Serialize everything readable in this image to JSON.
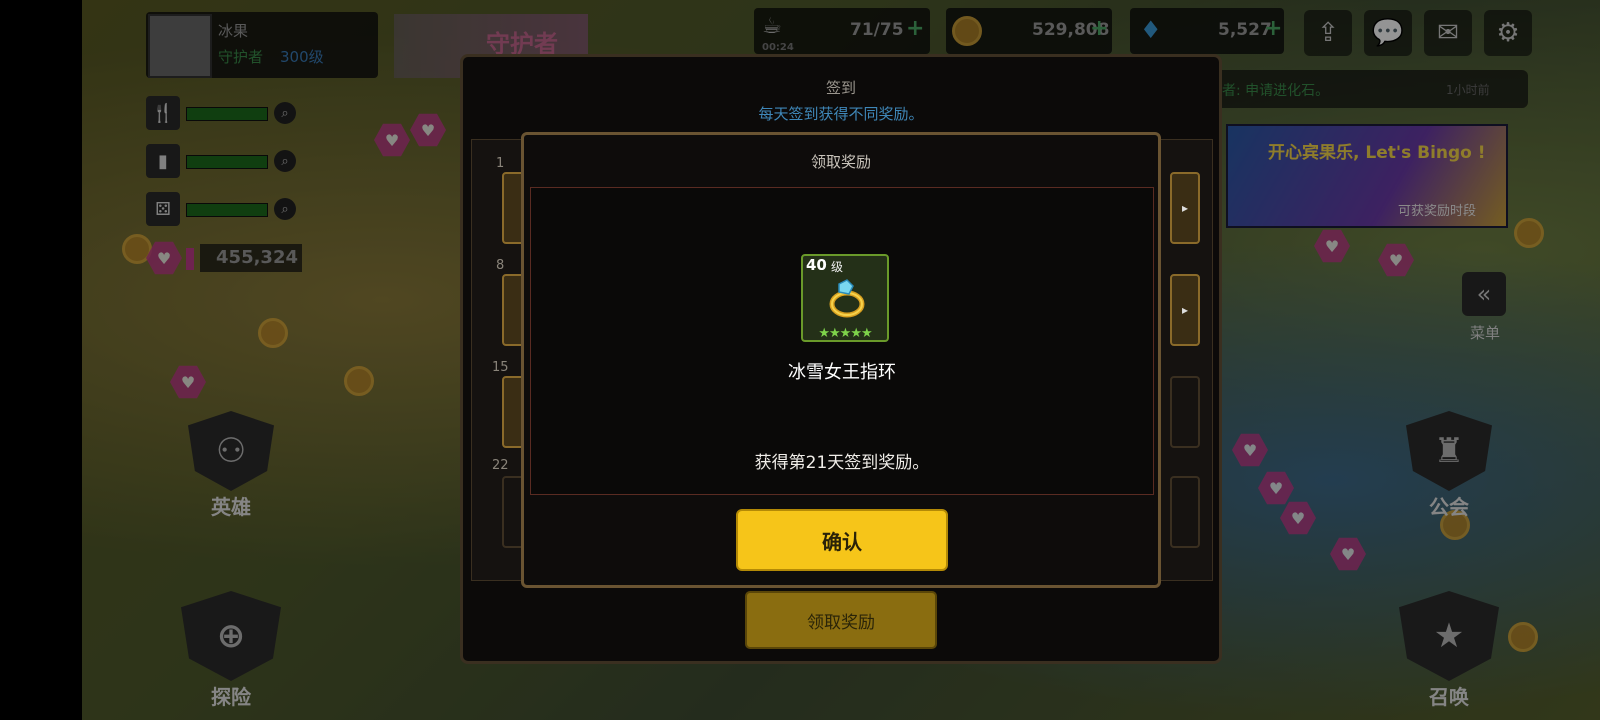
{
  "player": {
    "name": "冰果",
    "title": "守护者",
    "level": "300级",
    "banner_text": "守护者"
  },
  "stats": {
    "points": "455,324"
  },
  "resources": {
    "stamina": {
      "value": "71/75",
      "sub": "00:24"
    },
    "gold": {
      "value": "529,808"
    },
    "gems": {
      "value": "5,527"
    }
  },
  "chat": {
    "message": "者: 申请进化石。",
    "time": "1小时前"
  },
  "event_banner": {
    "title": "开心宾果乐, Let's Bingo !",
    "caption": "可获奖励时段"
  },
  "side_left": {
    "heroes": "英雄",
    "explore": "探险"
  },
  "side_right": {
    "menu": "菜单",
    "guild": "公会",
    "summon": "召唤"
  },
  "signin_dialog": {
    "title": "签到",
    "subtitle": "每天签到获得不同奖励。",
    "row_numbers": [
      "1",
      "8",
      "15",
      "22"
    ],
    "claim_button": "领取奖励"
  },
  "reward_modal": {
    "title": "领取奖励",
    "item": {
      "level": "40",
      "level_unit": "级",
      "stars": "★★★★★",
      "name": "冰雪女王指环"
    },
    "message": "获得第21天签到奖励。",
    "confirm_button": "确认"
  },
  "colors": {
    "confirm": "#f6c519",
    "subtitle": "#3f87b8",
    "stars": "#7ed34a",
    "accent_border": "#6a5432"
  }
}
